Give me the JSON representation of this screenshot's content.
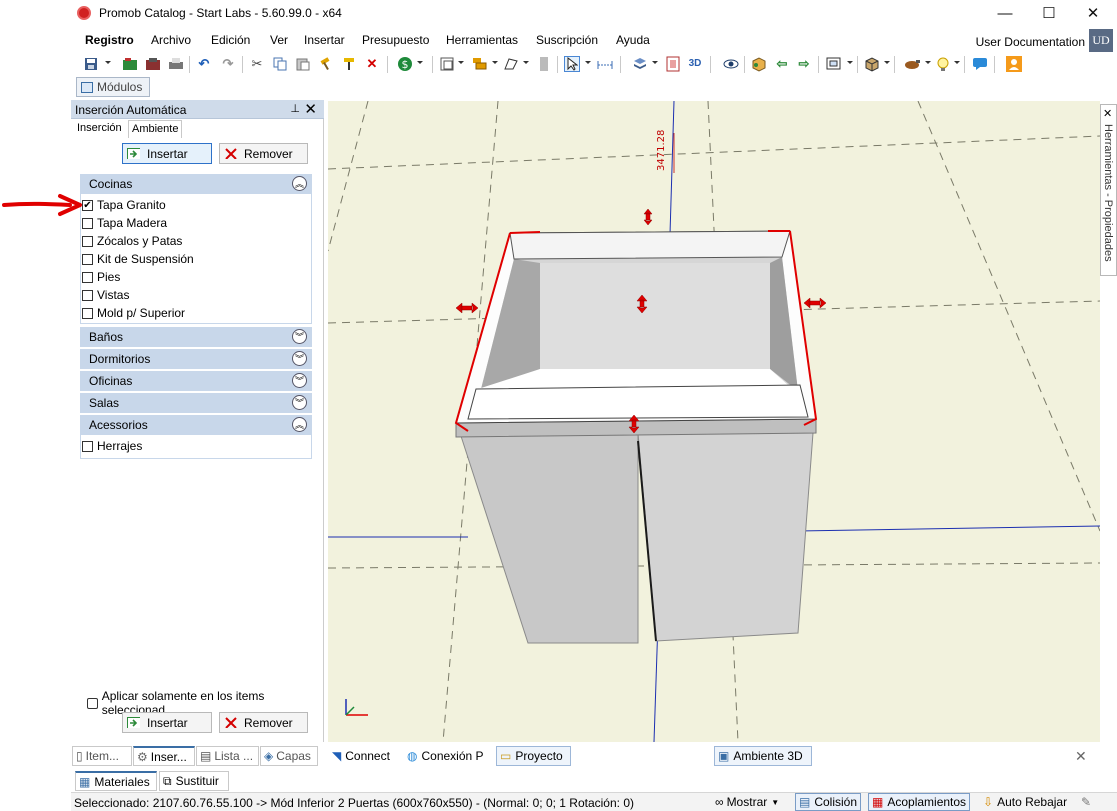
{
  "window": {
    "title": "Promob Catalog - Start Labs - 5.60.99.0 - x64",
    "minimize": "—",
    "maximize": "☐",
    "close": "✕"
  },
  "menubar": {
    "items": [
      "Registro",
      "Archivo",
      "Edición",
      "Ver",
      "Insertar",
      "Presupuesto",
      "Herramientas",
      "Suscripción",
      "Ayuda"
    ],
    "user": "User Documentation",
    "avatar": "UD"
  },
  "toolbar": {
    "icons": [
      "save-icon",
      "open-folder-icon",
      "catalog-icon",
      "print-icon",
      "undo-icon",
      "redo-icon",
      "cut-icon",
      "copy-icon",
      "paste-icon",
      "hammer-icon",
      "paint-roller-icon",
      "delete-icon",
      "budget-icon",
      "layout-icon",
      "stack-icon",
      "shape-icon",
      "wall-icon",
      "select-arrow-icon",
      "measure-icon",
      "layer-icon",
      "render-icon",
      "3d-view-icon",
      "eye-icon",
      "cube-plugin-icon",
      "arrow-left-icon",
      "arrow-right-icon",
      "frame-icon",
      "box-icon",
      "tools-icon",
      "light-icon",
      "chat-icon",
      "user-icon"
    ]
  },
  "modules_tab": {
    "label": "Módulos"
  },
  "left_panel": {
    "title": "Inserción Automática",
    "pin": "⊥",
    "close": "✕",
    "tabs": [
      "Inserción",
      "Ambiente"
    ],
    "insert_label": "Insertar",
    "remove_label": "Remover",
    "groups": [
      {
        "label": "Cocinas",
        "expanded": true,
        "items": [
          {
            "label": "Tapa Granito",
            "checked": true
          },
          {
            "label": "Tapa Madera",
            "checked": false
          },
          {
            "label": "Zócalos y Patas",
            "checked": false
          },
          {
            "label": "Kit de Suspensión",
            "checked": false
          },
          {
            "label": "Pies",
            "checked": false
          },
          {
            "label": "Vistas",
            "checked": false
          },
          {
            "label": "Mold p/ Superior",
            "checked": false
          }
        ]
      },
      {
        "label": "Baños",
        "expanded": false
      },
      {
        "label": "Dormitorios",
        "expanded": false
      },
      {
        "label": "Oficinas",
        "expanded": false
      },
      {
        "label": "Salas",
        "expanded": false
      },
      {
        "label": "Acessorios",
        "expanded": true,
        "items": [
          {
            "label": "Herrajes",
            "checked": false
          }
        ]
      }
    ],
    "apply_selected_label": "Aplicar solamente en los items seleccionad",
    "bottom_tabs": [
      "Item...",
      "Inser...",
      "Lista ...",
      "Capas"
    ]
  },
  "viewport": {
    "dimension_text": "3471.28"
  },
  "center_tabs": [
    "Connect",
    "Conexión P",
    "Proyecto"
  ],
  "viewport_tab": "Ambiente 3D",
  "right_tab": "Herramientas - Propiedades",
  "bottom_row_tabs": [
    "Materiales",
    "Sustituir"
  ],
  "status": {
    "text": "Seleccionado: 2107.60.76.55.100 -> Mód Inferior 2 Puertas  (600x760x550) - (Normal: 0; 0; 1 Rotación: 0)",
    "show_label": "Mostrar",
    "collision_label": "Colisión",
    "couplings_label": "Acoplamientos",
    "auto_lower_label": "Auto Rebajar"
  },
  "colors": {
    "accent": "#2e72c9",
    "panel_header": "#cfdbea",
    "group_header": "#c8d7ea",
    "viewport_bg": "#f2f2dd",
    "selection_red": "#e00000"
  }
}
